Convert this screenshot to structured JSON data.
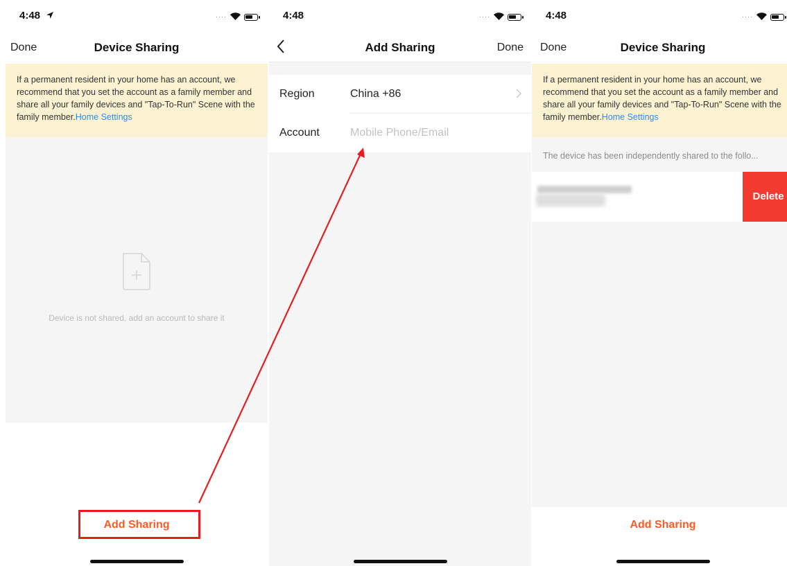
{
  "panels": [
    {
      "status": {
        "time": "4:48"
      },
      "nav": {
        "left": "Done",
        "title": "Device Sharing"
      },
      "notice": {
        "text": "If a permanent resident in your home has an account, we recommend that you set the account as a family member and share all your family devices and \"Tap-To-Run\" Scene with the family member.",
        "link": "Home Settings"
      },
      "empty_text": "Device is not shared, add an account to share it",
      "bottom_button": "Add Sharing"
    },
    {
      "status": {
        "time": "4:48"
      },
      "nav": {
        "title": "Add Sharing",
        "right": "Done"
      },
      "form": {
        "region_label": "Region",
        "region_value": "China +86",
        "account_label": "Account",
        "account_placeholder": "Mobile Phone/Email"
      }
    },
    {
      "status": {
        "time": "4:48"
      },
      "nav": {
        "left": "Done",
        "title": "Device Sharing"
      },
      "notice": {
        "text": "If a permanent resident in your home has an account, we recommend that you set the account as a family member and share all your family devices and \"Tap-To-Run\" Scene with the family member.",
        "link": "Home Settings"
      },
      "shared_text": "The device has been independently shared to the follo...",
      "delete_label": "Delete",
      "bottom_button": "Add Sharing"
    }
  ],
  "colors": {
    "accent_orange": "#ff5a26",
    "link_blue": "#2d8ce6",
    "notice_bg": "#fdf3d2",
    "delete_red": "#f23b30",
    "annotation_red": "#e51d1d"
  },
  "icons": {
    "status_location": "location-arrow-icon",
    "status_wifi": "wifi-icon",
    "status_battery": "battery-icon",
    "back": "chevron-left-icon",
    "region_chevron": "chevron-right-icon",
    "empty": "document-add-icon"
  }
}
